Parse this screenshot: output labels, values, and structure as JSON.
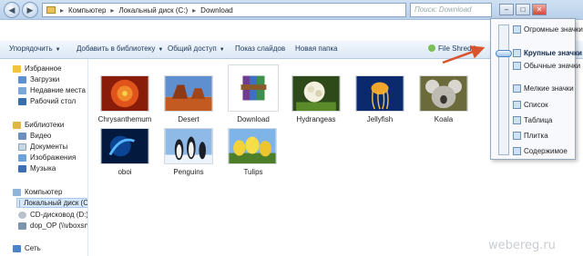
{
  "address_bar": {
    "crumbs": [
      "Компьютер",
      "Локальный диск (C:)",
      "Download"
    ],
    "search_placeholder": "Поиск: Download"
  },
  "toolbar": {
    "organize": "Упорядочить",
    "add_to_library": "Добавить в библиотеку",
    "share": "Общий доступ",
    "slideshow": "Показ слайдов",
    "new_folder": "Новая папка",
    "file_shredder": "File Shredder"
  },
  "sidebar": {
    "favorites": {
      "title": "Избранное",
      "items": [
        "Загрузки",
        "Недавние места",
        "Рабочий стол"
      ]
    },
    "libraries": {
      "title": "Библиотеки",
      "items": [
        "Видео",
        "Документы",
        "Изображения",
        "Музыка"
      ]
    },
    "computer": {
      "title": "Компьютер",
      "items": [
        "Локальный диск (C",
        "CD-дисковод (D:) Vi",
        "dop_OP (\\\\vboxsrv)"
      ]
    },
    "network": {
      "title": "Сеть"
    }
  },
  "files": [
    {
      "name": "Chrysanthemum",
      "icon": "image-thumb"
    },
    {
      "name": "Desert",
      "icon": "image-thumb"
    },
    {
      "name": "Download",
      "icon": "archive-icon"
    },
    {
      "name": "Hydrangeas",
      "icon": "image-thumb"
    },
    {
      "name": "Jellyfish",
      "icon": "image-thumb"
    },
    {
      "name": "Koala",
      "icon": "image-thumb"
    },
    {
      "name": "oboi",
      "icon": "image-thumb"
    },
    {
      "name": "Penguins",
      "icon": "image-thumb"
    },
    {
      "name": "Tulips",
      "icon": "image-thumb"
    }
  ],
  "view_menu": {
    "items": [
      "Огромные значки",
      "Крупные значки",
      "Обычные значки",
      "Мелкие значки",
      "Список",
      "Таблица",
      "Плитка",
      "Содержимое"
    ],
    "selected": "Крупные значки"
  },
  "watermark": "webereg.ru",
  "colors": {
    "accent": "#3b78c4",
    "arrow": "#d9532c",
    "selection": "#d6e8fb"
  }
}
